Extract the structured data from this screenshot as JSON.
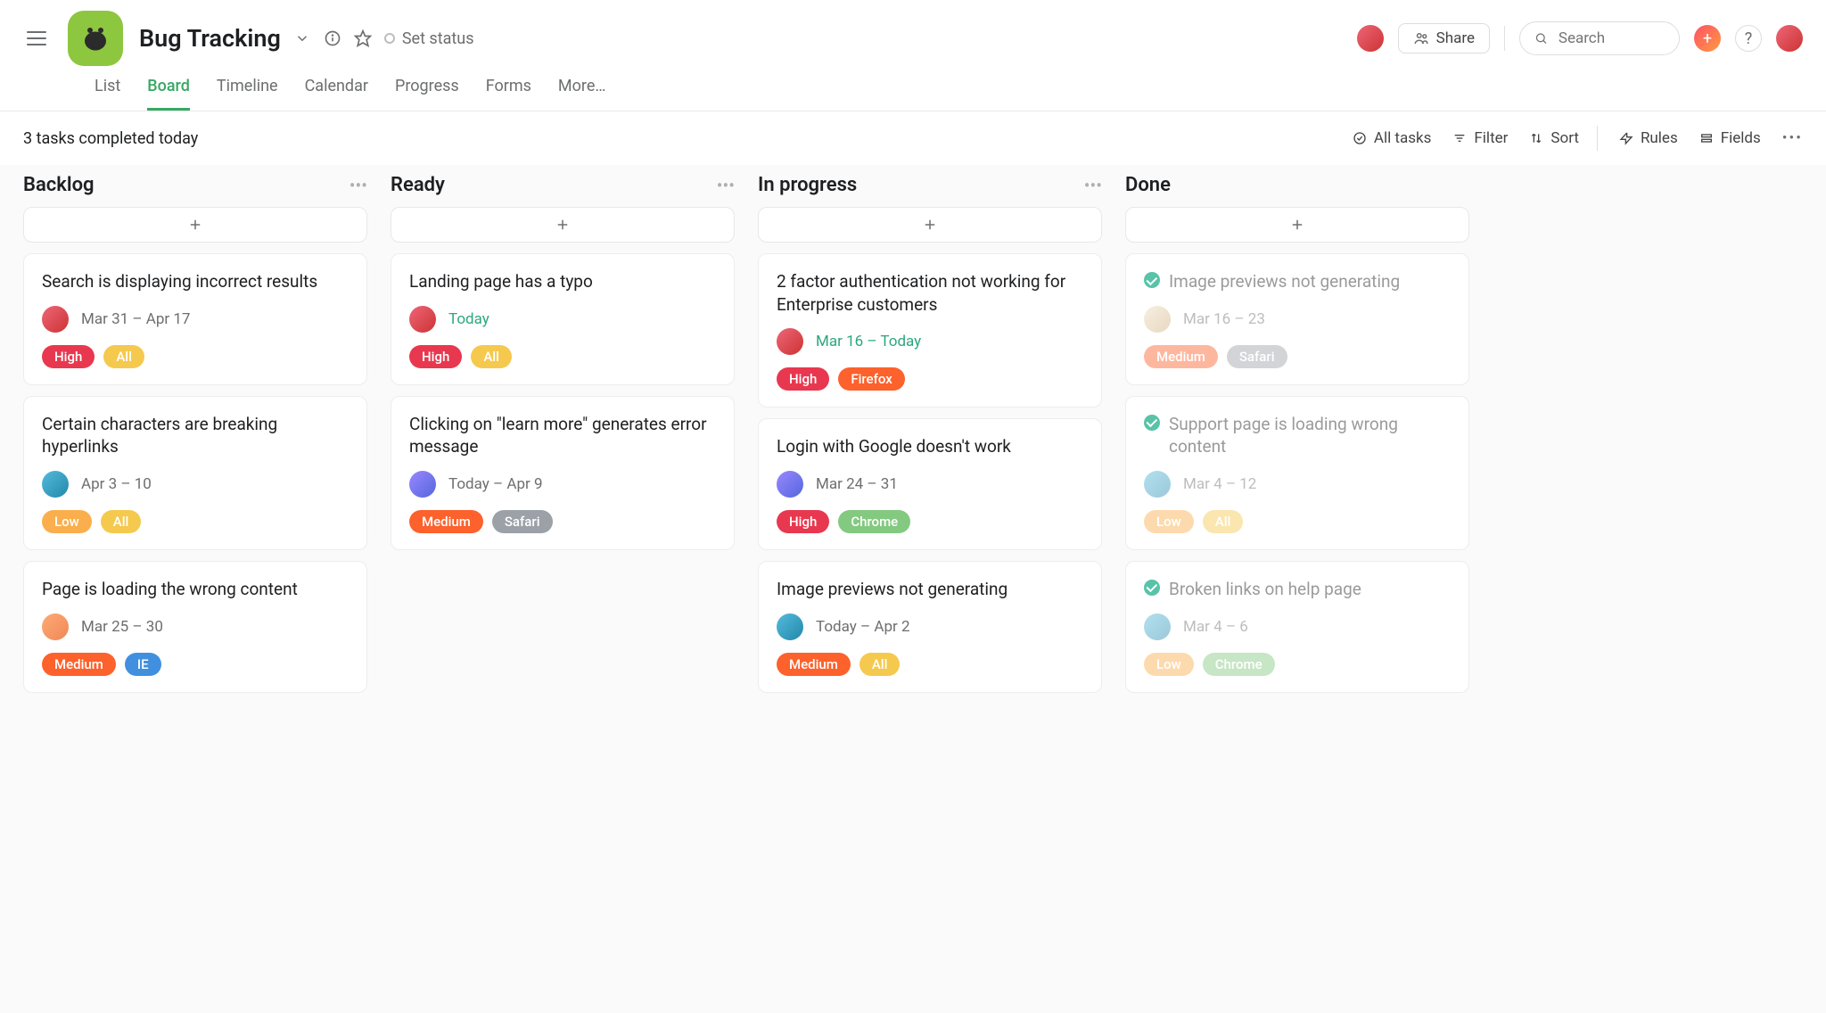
{
  "project_title": "Bug Tracking",
  "set_status": "Set status",
  "share": "Share",
  "search_placeholder": "Search",
  "tabs": {
    "list": "List",
    "board": "Board",
    "timeline": "Timeline",
    "calendar": "Calendar",
    "progress": "Progress",
    "forms": "Forms",
    "more": "More…"
  },
  "status_line": "3 tasks completed today",
  "toolbar": {
    "all": "All tasks",
    "filter": "Filter",
    "sort": "Sort",
    "rules": "Rules",
    "fields": "Fields"
  },
  "columns": [
    {
      "title": "Backlog",
      "cards": [
        {
          "title": "Search is displaying incorrect results",
          "date": "Mar 31 – Apr 17",
          "avatar": "av-1",
          "tags": [
            {
              "label": "High",
              "class": "high"
            },
            {
              "label": "All",
              "class": "all"
            }
          ]
        },
        {
          "title": "Certain characters are breaking hyperlinks",
          "date": "Apr 3 – 10",
          "avatar": "av-2",
          "tags": [
            {
              "label": "Low",
              "class": "low"
            },
            {
              "label": "All",
              "class": "all"
            }
          ]
        },
        {
          "title": "Page is loading the wrong content",
          "date": "Mar 25 – 30",
          "avatar": "av-4",
          "tags": [
            {
              "label": "Medium",
              "class": "medium"
            },
            {
              "label": "IE",
              "class": "ie"
            }
          ]
        }
      ]
    },
    {
      "title": "Ready",
      "cards": [
        {
          "title": "Landing page has a typo",
          "date": "Today",
          "dateClass": "today",
          "avatar": "av-1",
          "tags": [
            {
              "label": "High",
              "class": "high"
            },
            {
              "label": "All",
              "class": "all"
            }
          ]
        },
        {
          "title": "Clicking on \"learn more\" generates error message",
          "date": "Today – Apr 9",
          "avatar": "av-3",
          "tags": [
            {
              "label": "Medium",
              "class": "medium"
            },
            {
              "label": "Safari",
              "class": "safari"
            }
          ]
        }
      ]
    },
    {
      "title": "In progress",
      "cards": [
        {
          "title": "2 factor authentication not working for Enterprise customers",
          "date": "Mar 16 – Today",
          "dateClass": "today",
          "avatar": "av-1",
          "tags": [
            {
              "label": "High",
              "class": "high"
            },
            {
              "label": "Firefox",
              "class": "firefox"
            }
          ]
        },
        {
          "title": "Login with Google doesn't work",
          "date": "Mar 24 – 31",
          "avatar": "av-3",
          "tags": [
            {
              "label": "High",
              "class": "high"
            },
            {
              "label": "Chrome",
              "class": "chrome"
            }
          ]
        },
        {
          "title": "Image previews not generating",
          "date": "Today – Apr 2",
          "avatar": "av-2",
          "tags": [
            {
              "label": "Medium",
              "class": "medium"
            },
            {
              "label": "All",
              "class": "all"
            }
          ]
        }
      ]
    },
    {
      "title": "Done",
      "done": true,
      "cards": [
        {
          "title": "Image previews not generating",
          "date": "Mar 16 – 23",
          "avatar": "av-5",
          "tags": [
            {
              "label": "Medium",
              "class": "medium"
            },
            {
              "label": "Safari",
              "class": "safari"
            }
          ]
        },
        {
          "title": "Support page is loading wrong content",
          "date": "Mar 4 – 12",
          "avatar": "av-2",
          "tags": [
            {
              "label": "Low",
              "class": "low"
            },
            {
              "label": "All",
              "class": "all"
            }
          ]
        },
        {
          "title": "Broken links on help page",
          "date": "Mar 4 – 6",
          "avatar": "av-2",
          "tags": [
            {
              "label": "Low",
              "class": "low"
            },
            {
              "label": "Chrome",
              "class": "chrome"
            }
          ]
        }
      ]
    }
  ]
}
